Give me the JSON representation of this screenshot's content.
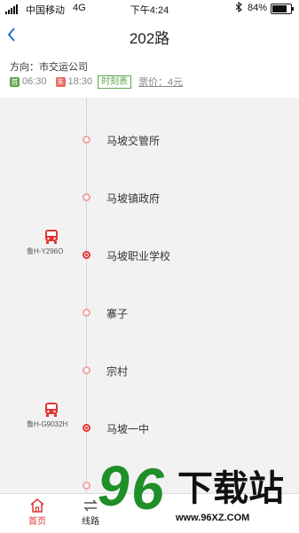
{
  "status_bar": {
    "carrier": "中国移动",
    "network": "4G",
    "time": "下午4:24",
    "battery_pct": "84%",
    "battery_level": 0.84
  },
  "nav": {
    "title": "202路",
    "back_icon": "chevron-left-icon"
  },
  "info": {
    "direction": "方向：市交运公司",
    "first_badge": "首",
    "first_time": "06:30",
    "last_badge": "末",
    "last_time": "18:30",
    "timetable_label": "时刻表",
    "fare": "票价：4元"
  },
  "stops": [
    {
      "name": "马坡交管所",
      "current": false
    },
    {
      "name": "马坡镇政府",
      "current": false
    },
    {
      "name": "马坡职业学校",
      "current": true
    },
    {
      "name": "寨子",
      "current": false
    },
    {
      "name": "宗村",
      "current": false
    },
    {
      "name": "马坡一中",
      "current": true
    },
    {
      "name": "",
      "current": false
    }
  ],
  "buses": [
    {
      "plate": "鲁H-Y296O",
      "at_stop": 2
    },
    {
      "plate": "鲁H-G9032H",
      "at_stop": 5
    }
  ],
  "tabs": [
    {
      "label": "首页",
      "icon": "home-icon",
      "active": true
    },
    {
      "label": "线路",
      "icon": "swap-arrows-icon",
      "active": false
    }
  ],
  "colors": {
    "accent": "#e23333",
    "green": "#5aa64b",
    "line_bg": "#f2f2f2"
  },
  "watermark": {
    "brand": "96下载站",
    "url": "www.96XZ.COM"
  }
}
